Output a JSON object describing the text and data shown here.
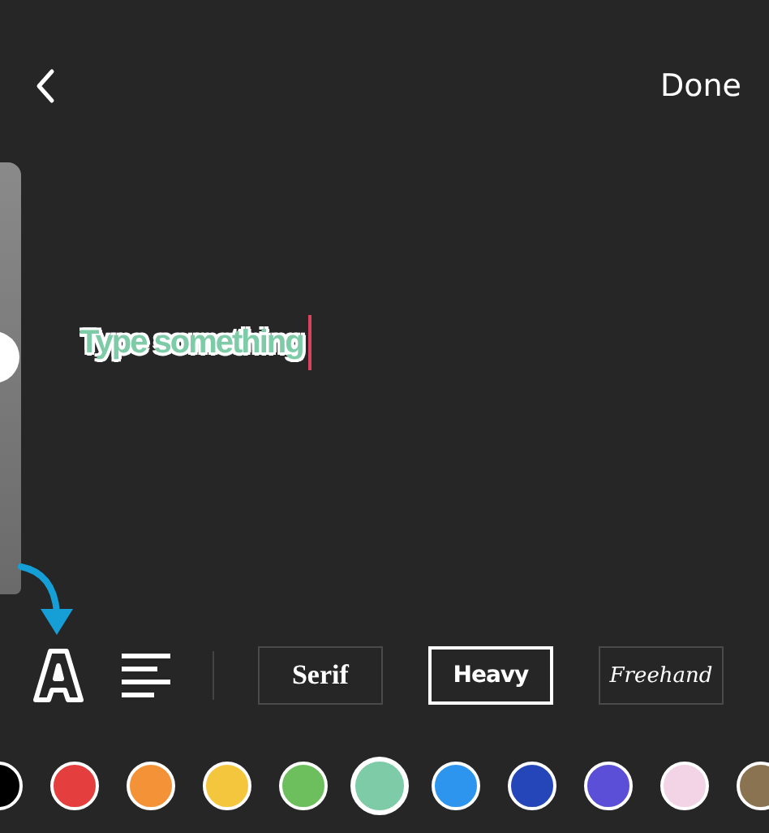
{
  "header": {
    "done": "Done"
  },
  "text_field": {
    "placeholder": "Type something"
  },
  "size_slider": {
    "level": 0.55
  },
  "font_styles": [
    {
      "label": "Serif",
      "kind": "serif",
      "selected": false
    },
    {
      "label": "Heavy",
      "kind": "heavy",
      "selected": true
    },
    {
      "label": "Freehand",
      "kind": "freehand",
      "selected": false
    }
  ],
  "colors": [
    {
      "color": "#000000",
      "selected": false
    },
    {
      "color": "#e53e3e",
      "selected": false
    },
    {
      "color": "#f39237",
      "selected": false
    },
    {
      "color": "#f4c63d",
      "selected": false
    },
    {
      "color": "#6cbf5c",
      "selected": false
    },
    {
      "color": "#7ecba7",
      "selected": true
    },
    {
      "color": "#2d95ed",
      "selected": false
    },
    {
      "color": "#2446b8",
      "selected": false
    },
    {
      "color": "#5b4fd8",
      "selected": false
    },
    {
      "color": "#f3d3e6",
      "selected": false
    },
    {
      "color": "#8a7350",
      "selected": false
    }
  ]
}
